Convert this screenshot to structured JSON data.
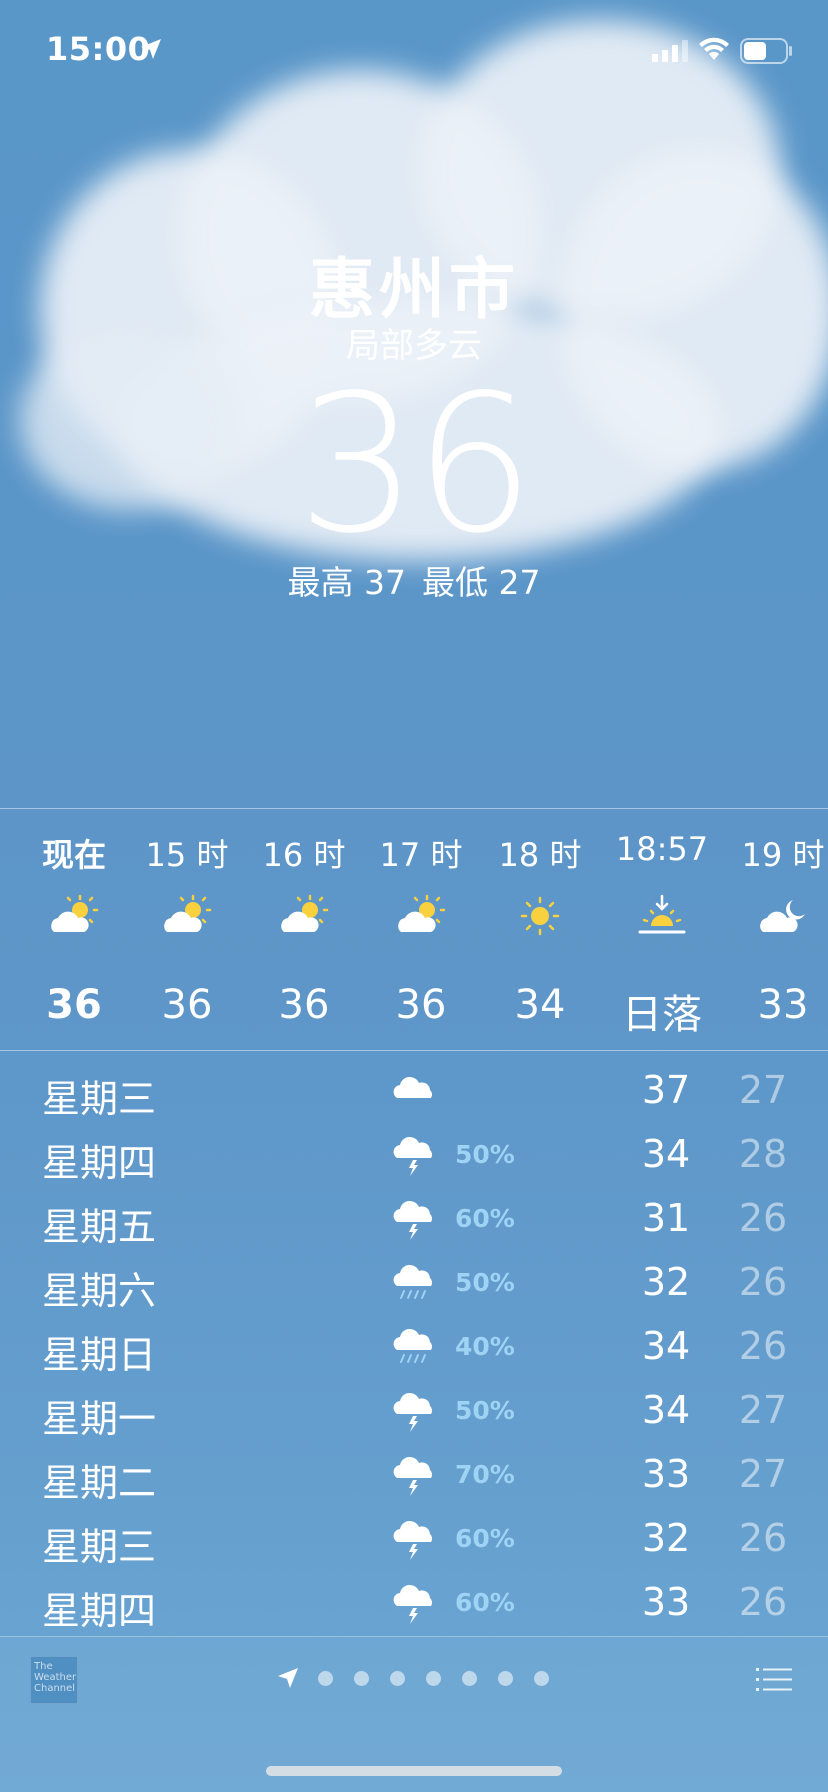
{
  "status_bar": {
    "time": "15:00"
  },
  "header": {
    "city": "惠州市",
    "condition": "局部多云",
    "temperature": "36",
    "high_label": "最高 37",
    "low_label": "最低 27"
  },
  "hourly": [
    {
      "label": "现在",
      "icon": "partly-sunny-icon",
      "temp": "36"
    },
    {
      "label": "15 时",
      "icon": "partly-sunny-icon",
      "temp": "36"
    },
    {
      "label": "16 时",
      "icon": "partly-sunny-icon",
      "temp": "36"
    },
    {
      "label": "17 时",
      "icon": "partly-sunny-icon",
      "temp": "36"
    },
    {
      "label": "18 时",
      "icon": "sun-icon",
      "temp": "34"
    },
    {
      "label": "18:57",
      "icon": "sunset-icon",
      "temp": "日落"
    },
    {
      "label": "19 时",
      "icon": "partly-cloudy-night-icon",
      "temp": "33"
    }
  ],
  "daily": [
    {
      "day": "星期三",
      "icon": "cloud-icon",
      "pct": "",
      "high": "37",
      "low": "27"
    },
    {
      "day": "星期四",
      "icon": "thunderstorm-icon",
      "pct": "50%",
      "high": "34",
      "low": "28"
    },
    {
      "day": "星期五",
      "icon": "thunderstorm-icon",
      "pct": "60%",
      "high": "31",
      "low": "26"
    },
    {
      "day": "星期六",
      "icon": "rain-icon",
      "pct": "50%",
      "high": "32",
      "low": "26"
    },
    {
      "day": "星期日",
      "icon": "rain-icon",
      "pct": "40%",
      "high": "34",
      "low": "26"
    },
    {
      "day": "星期一",
      "icon": "thunderstorm-icon",
      "pct": "50%",
      "high": "34",
      "low": "27"
    },
    {
      "day": "星期二",
      "icon": "thunderstorm-icon",
      "pct": "70%",
      "high": "33",
      "low": "27"
    },
    {
      "day": "星期三",
      "icon": "thunderstorm-icon",
      "pct": "60%",
      "high": "32",
      "low": "26"
    },
    {
      "day": "星期四",
      "icon": "thunderstorm-icon",
      "pct": "60%",
      "high": "33",
      "low": "26"
    }
  ],
  "footer": {
    "weather_channel_logo": "The Weather Channel",
    "page_dots_count": 7
  },
  "colors": {
    "sky": "#5b96c9",
    "precip_text": "#9fd3f4",
    "sun": "#f9d13e"
  }
}
